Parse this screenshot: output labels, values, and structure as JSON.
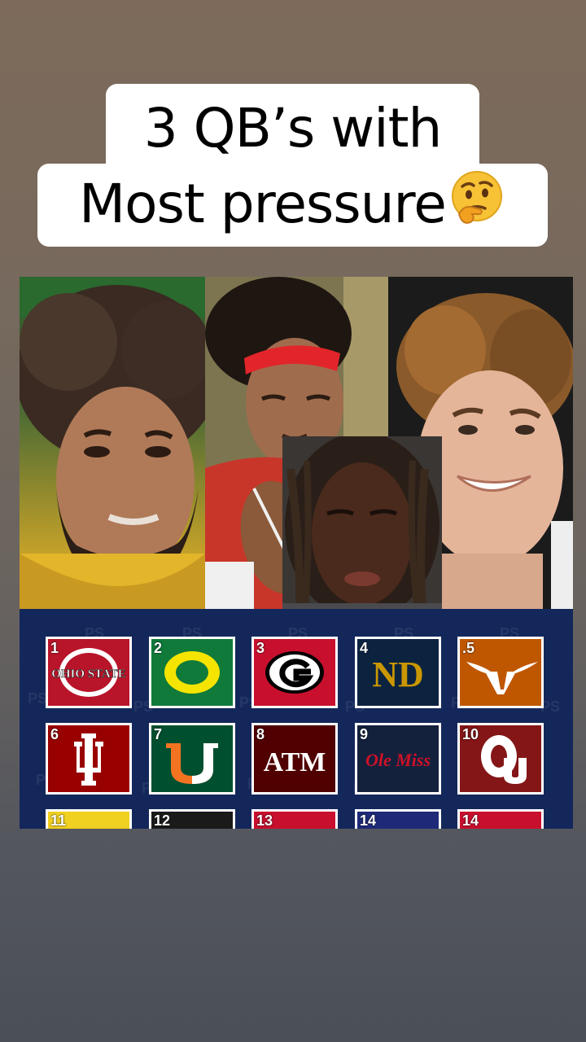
{
  "caption": {
    "line1": "3 QB’s with",
    "line2": "Most pressure"
  },
  "emoji_icon": "thinking-face-emoji",
  "rankings": [
    {
      "rank": "1",
      "team": "OHIO STATE",
      "bg": "#b8142a"
    },
    {
      "rank": "2",
      "team": "O",
      "bg": "#0f7a3a"
    },
    {
      "rank": "3",
      "team": "G",
      "bg": "#c8102e"
    },
    {
      "rank": "4",
      "team": "ND",
      "bg": "#0c2340"
    },
    {
      "rank": ".5",
      "team": "Longhorn",
      "bg": "#bf5700"
    },
    {
      "rank": "6",
      "team": "IU",
      "bg": "#990000"
    },
    {
      "rank": "7",
      "team": "U",
      "bg": "#005030"
    },
    {
      "rank": "8",
      "team": "ATM",
      "bg": "#500000"
    },
    {
      "rank": "9",
      "team": "Ole Miss",
      "bg": "#14213d"
    },
    {
      "rank": "10",
      "team": "OU",
      "bg": "#841617"
    },
    {
      "rank": "11",
      "team": "",
      "bg": "#f0d020"
    },
    {
      "rank": "12",
      "team": "",
      "bg": "#1a1a1a"
    },
    {
      "rank": "13",
      "team": "",
      "bg": "#c8102e"
    },
    {
      "rank": "14",
      "team": "",
      "bg": "#1e2a78"
    },
    {
      "rank": "14",
      "team": "",
      "bg": "#c8102e"
    }
  ],
  "watermark": "PS"
}
